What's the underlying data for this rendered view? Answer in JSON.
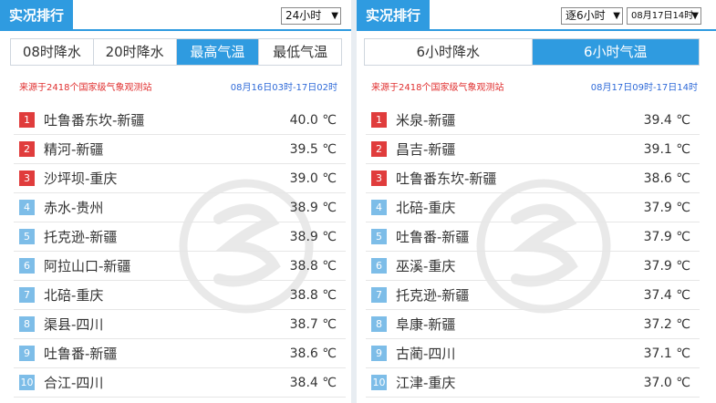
{
  "left": {
    "title": "实况排行",
    "period_select": "24小时",
    "tabs": [
      "08时降水",
      "20时降水",
      "最高气温",
      "最低气温"
    ],
    "active_tab": 2,
    "source": "来源于2418个国家级气象观测站",
    "range": "08月16日03时-17日02时",
    "rows": [
      {
        "rank": "1",
        "name": "吐鲁番东坎-新疆",
        "value": "40.0 ℃"
      },
      {
        "rank": "2",
        "name": "精河-新疆",
        "value": "39.5 ℃"
      },
      {
        "rank": "3",
        "name": "沙坪坝-重庆",
        "value": "39.0 ℃"
      },
      {
        "rank": "4",
        "name": "赤水-贵州",
        "value": "38.9 ℃"
      },
      {
        "rank": "5",
        "name": "托克逊-新疆",
        "value": "38.9 ℃"
      },
      {
        "rank": "6",
        "name": "阿拉山口-新疆",
        "value": "38.8 ℃"
      },
      {
        "rank": "7",
        "name": "北碚-重庆",
        "value": "38.8 ℃"
      },
      {
        "rank": "8",
        "name": "渠县-四川",
        "value": "38.7 ℃"
      },
      {
        "rank": "9",
        "name": "吐鲁番-新疆",
        "value": "38.6 ℃"
      },
      {
        "rank": "10",
        "name": "合江-四川",
        "value": "38.4 ℃"
      }
    ]
  },
  "right": {
    "title": "实况排行",
    "period_select": "逐6小时",
    "time_select": "08月17日14时",
    "tabs": [
      "6小时降水",
      "6小时气温"
    ],
    "active_tab": 1,
    "source": "来源于2418个国家级气象观测站",
    "range": "08月17日09时-17日14时",
    "rows": [
      {
        "rank": "1",
        "name": "米泉-新疆",
        "value": "39.4 ℃"
      },
      {
        "rank": "2",
        "name": "昌吉-新疆",
        "value": "39.1 ℃"
      },
      {
        "rank": "3",
        "name": "吐鲁番东坎-新疆",
        "value": "38.6 ℃"
      },
      {
        "rank": "4",
        "name": "北碚-重庆",
        "value": "37.9 ℃"
      },
      {
        "rank": "5",
        "name": "吐鲁番-新疆",
        "value": "37.9 ℃"
      },
      {
        "rank": "6",
        "name": "巫溪-重庆",
        "value": "37.9 ℃"
      },
      {
        "rank": "7",
        "name": "托克逊-新疆",
        "value": "37.4 ℃"
      },
      {
        "rank": "8",
        "name": "阜康-新疆",
        "value": "37.2 ℃"
      },
      {
        "rank": "9",
        "name": "古蔺-四川",
        "value": "37.1 ℃"
      },
      {
        "rank": "10",
        "name": "江津-重庆",
        "value": "37.0 ℃"
      }
    ]
  },
  "colors": {
    "accent": "#2f9be0",
    "top_rank": "#e03c3c",
    "rank": "#7dbde8",
    "source_text": "#e03030",
    "range_text": "#2f6ad8"
  }
}
